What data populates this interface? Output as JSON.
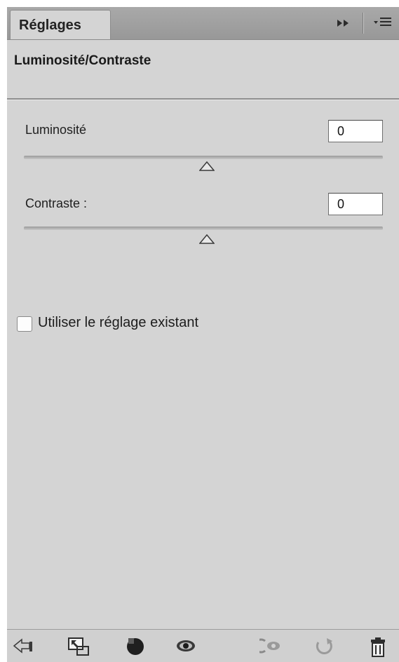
{
  "panel": {
    "tab_label": "Réglages",
    "title": "Luminosité/Contraste"
  },
  "sliders": [
    {
      "label": "Luminosité",
      "value": "0"
    },
    {
      "label": "Contraste :",
      "value": "0"
    }
  ],
  "checkbox": {
    "label": "Utiliser le réglage existant",
    "checked": false
  },
  "icons": {
    "tabbar": [
      "collapse-icon",
      "panel-menu-icon"
    ],
    "footer": [
      "back-arrow-icon",
      "clip-to-layer-icon",
      "layer-mask-icon",
      "visibility-eye-icon",
      "view-previous-state-icon",
      "reset-icon",
      "delete-trash-icon"
    ]
  },
  "colors": {
    "panel_bg": "#d4d4d4",
    "tabbar_bg": "#a0a0a0",
    "text": "#1f1f1f"
  }
}
